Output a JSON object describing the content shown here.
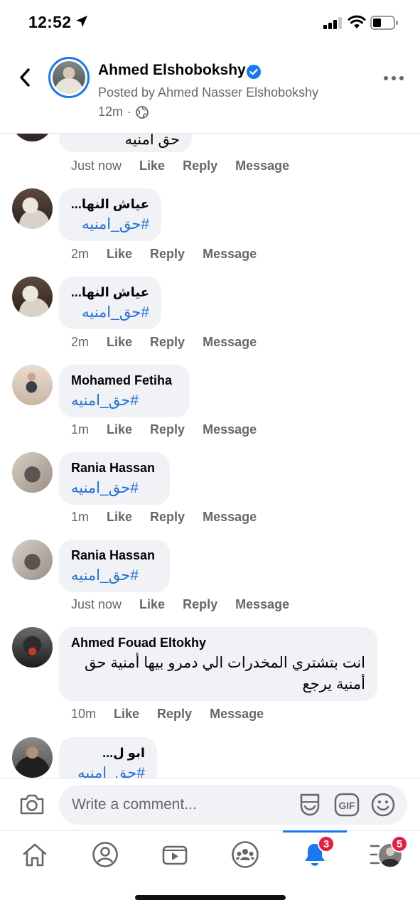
{
  "status_bar": {
    "time": "12:52"
  },
  "post": {
    "author": "Ahmed Elshobokshy",
    "posted_by": "Posted by Ahmed Nasser Elshobokshy",
    "time": "12m",
    "separator": "·"
  },
  "comments": [
    {
      "name": "",
      "tag": "حق امنيه",
      "time": "Just now"
    },
    {
      "name": "عياش النها...",
      "tag": "#حق_امنيه",
      "time": "2m"
    },
    {
      "name": "عياش النها...",
      "tag": "#حق_امنيه",
      "time": "2m"
    },
    {
      "name": "Mohamed Fetiha",
      "tag": "#حق_امنيه",
      "time": "1m"
    },
    {
      "name": "Rania Hassan",
      "tag": "#حق_امنيه",
      "time": "1m"
    },
    {
      "name": "Rania Hassan",
      "tag": "#حق_امنيه",
      "time": "Just now"
    },
    {
      "name": "Ahmed Fouad Eltokhy",
      "text": "انت بتشتري المخدرات الي دمرو بيها أمنية حق أمنية يرجع",
      "time": "10m"
    },
    {
      "name": "ابو ل...",
      "tag": "#حق_امنيه"
    }
  ],
  "actions": {
    "like": "Like",
    "reply": "Reply",
    "message": "Message"
  },
  "comment_input": {
    "placeholder": "Write a comment..."
  },
  "icons": {
    "back": "chevron-left-icon",
    "more": "more-dots-icon",
    "camera": "camera-icon",
    "sticker": "sticker-icon",
    "gif": "gif-icon",
    "emoji": "emoji-icon",
    "home": "home-icon",
    "profile": "profile-icon",
    "watch": "video-icon",
    "groups": "groups-icon",
    "notifications": "bell-icon",
    "menu": "menu-icon"
  },
  "nav": {
    "notifications_badge": "3",
    "menu_badge": "5"
  },
  "colors": {
    "accent": "#1877f2",
    "link": "#216fdb",
    "badge": "#e41e3f",
    "bubble": "#f0f2f5",
    "muted": "#65676b"
  }
}
